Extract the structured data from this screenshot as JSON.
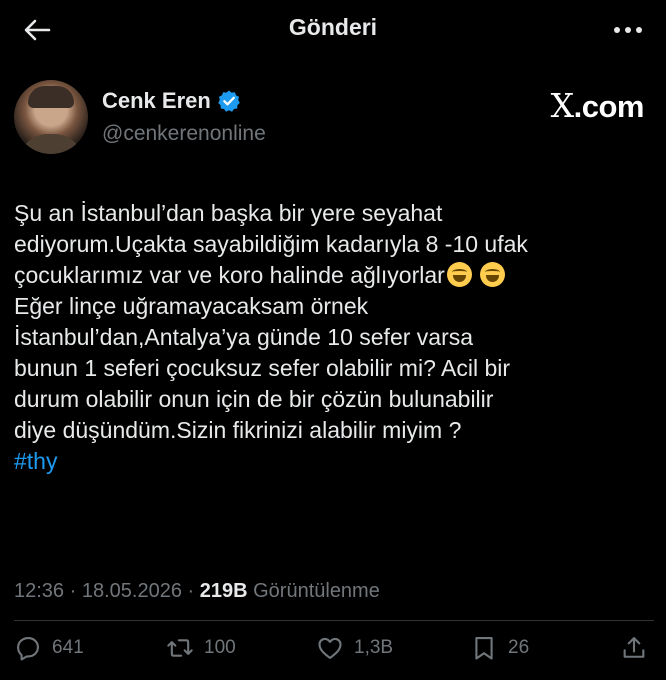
{
  "header": {
    "title": "Gönderi",
    "back_icon": "arrow-left-icon",
    "more_icon": "more-horizontal-icon"
  },
  "author": {
    "name": "Cenk Eren",
    "handle": "@cenkerenonline",
    "verified": true,
    "verified_color": "#1d9bf0"
  },
  "watermark": {
    "x_glyph": "X",
    "domain": ".com"
  },
  "tweet": {
    "lines": [
      "Şu an İstanbul’dan başka bir yere seyahat",
      "ediyorum.Uçakta sayabildiğim kadarıyla 8 -10 ufak",
      "çocuklarımız var ve koro halinde ağlıyorlar",
      "Eğer linçe uğramayacaksam örnek",
      "İstanbul’dan,Antalya’ya günde 10 sefer varsa",
      "bunun 1 seferi çocuksuz sefer olabilir mi? Acil bir",
      "durum olabilir onun için de bir çözün bulunabilir",
      "diye düşündüm.Sizin fikrinizi alabilir miyim ?"
    ],
    "emoji": "face-with-tears-of-joy",
    "hashtag": "#thy",
    "link_color": "#1d9bf0"
  },
  "meta": {
    "time": "12:36",
    "sep1": " · ",
    "date": "18.05.2026",
    "sep2": " · ",
    "views": "219B",
    "views_label": " Görüntülenme"
  },
  "actions": {
    "replies": "641",
    "reposts": "100",
    "likes": "1,3B",
    "bookmarks": "26"
  }
}
